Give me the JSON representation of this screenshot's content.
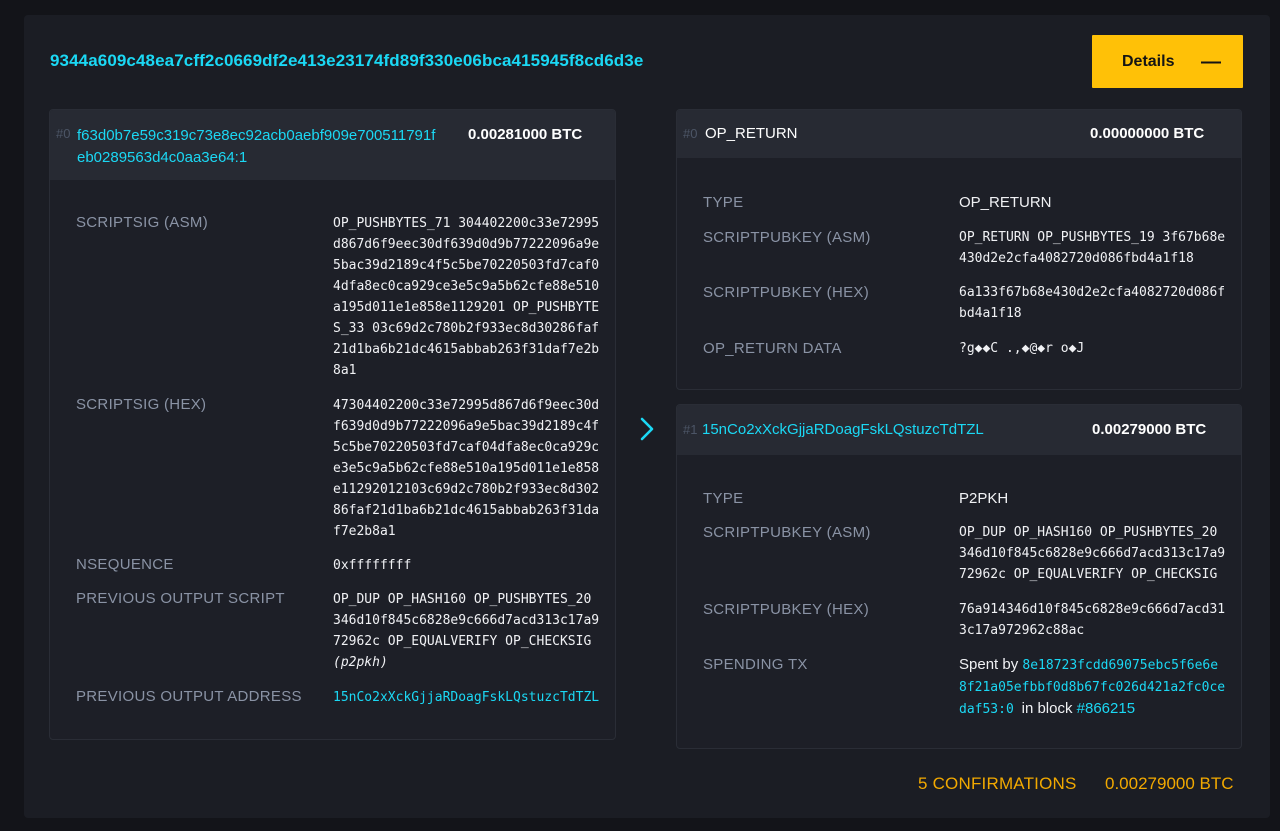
{
  "txid": "9344a609c48ea7cff2c0669df2e413e23174fd89f330e06bca415945f8cd6d3e",
  "details_button": {
    "label": "Details",
    "toggle_icon": "minus-icon"
  },
  "input": {
    "index": "#0",
    "prev_txid_line1": "f63d0b7e59c319c73e8ec92acb0aebf909e700511791f",
    "prev_txid_line2": "eb0289563d4c0aa3e64:1",
    "amount": "0.00281000 BTC",
    "fields": {
      "scriptsig_asm": {
        "label": "SCRIPTSIG (ASM)",
        "lines": [
          "OP_PUSHBYTES_71 304402200c33e72995",
          "d867d6f9eec30df639d0d9b77222096a9e",
          "5bac39d2189c4f5c5be70220503fd7caf0",
          "4dfa8ec0ca929ce3e5c9a5b62cfe88e510",
          "a195d011e1e858e1129201 OP_PUSHBYTE",
          "S_33 03c69d2c780b2f933ec8d30286faf",
          "21d1ba6b21dc4615abbab263f31daf7e2b",
          "8a1"
        ]
      },
      "scriptsig_hex": {
        "label": "SCRIPTSIG (HEX)",
        "lines": [
          "47304402200c33e72995d867d6f9eec30d",
          "f639d0d9b77222096a9e5bac39d2189c4f",
          "5c5be70220503fd7caf04dfa8ec0ca929c",
          "e3e5c9a5b62cfe88e510a195d011e1e858",
          "e11292012103c69d2c780b2f933ec8d302",
          "86faf21d1ba6b21dc4615abbab263f31da",
          "f7e2b8a1"
        ]
      },
      "nsequence": {
        "label": "NSEQUENCE",
        "value": "0xffffffff"
      },
      "prev_output_script": {
        "label": "PREVIOUS OUTPUT SCRIPT",
        "lines": [
          "OP_DUP OP_HASH160 OP_PUSHBYTES_20",
          "346d10f845c6828e9c666d7acd313c17a9",
          "72962c OP_EQUALVERIFY OP_CHECKSIG"
        ],
        "type_note": "(p2pkh)"
      },
      "prev_output_address": {
        "label": "PREVIOUS OUTPUT ADDRESS",
        "value": "15nCo2xXckGjjaRDoagFskLQstuzcTdTZL"
      }
    }
  },
  "outputs": [
    {
      "index": "#0",
      "title": "OP_RETURN",
      "amount": "0.00000000 BTC",
      "type_label": "TYPE",
      "type_value": "OP_RETURN",
      "asm_label": "SCRIPTPUBKEY (ASM)",
      "asm_lines": [
        "OP_RETURN OP_PUSHBYTES_19 3f67b68e",
        "430d2e2cfa4082720d086fbd4a1f18"
      ],
      "hex_label": "SCRIPTPUBKEY (HEX)",
      "hex_lines": [
        "6a133f67b68e430d2e2cfa4082720d086f",
        "bd4a1f18"
      ],
      "data_label": "OP_RETURN DATA",
      "data_value": "?g◆◆C .,◆@◆r o◆J"
    },
    {
      "index": "#1",
      "address": "15nCo2xXckGjjaRDoagFskLQstuzcTdTZL",
      "amount": "0.00279000 BTC",
      "type_label": "TYPE",
      "type_value": "P2PKH",
      "asm_label": "SCRIPTPUBKEY (ASM)",
      "asm_lines": [
        "OP_DUP OP_HASH160 OP_PUSHBYTES_20",
        "346d10f845c6828e9c666d7acd313c17a9",
        "72962c OP_EQUALVERIFY OP_CHECKSIG"
      ],
      "hex_label": "SCRIPTPUBKEY (HEX)",
      "hex_lines": [
        "76a914346d10f845c6828e9c666d7acd31",
        "3c17a972962c88ac"
      ],
      "spending_label": "SPENDING TX",
      "spent_by_prefix": "Spent by",
      "spending_txid_lines": [
        "8e18723fcdd69075ebc5f6e6e",
        "8f21a05efbbf0d8b67fc026d421a2fc0ce",
        "daf53:0"
      ],
      "in_block_text": "in block",
      "block": "#866215"
    }
  ],
  "footer": {
    "confirmations": "5 CONFIRMATIONS",
    "total": "0.00279000 BTC"
  },
  "colors": {
    "accent": "#ffc107",
    "link": "#1bd8f4",
    "footer": "#f2a900"
  }
}
